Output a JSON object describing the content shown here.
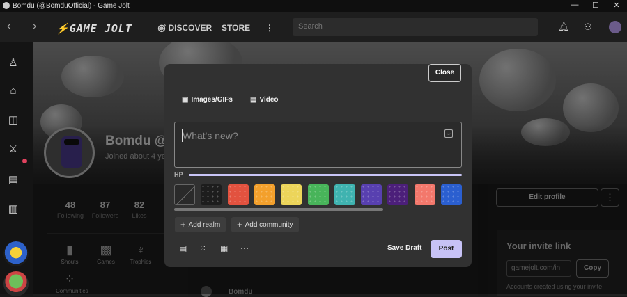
{
  "window": {
    "title": "Bomdu (@BomduOfficial) - Game Jolt",
    "minimize": "—",
    "maximize": "☐",
    "close": "✕"
  },
  "nav": {
    "back": "‹",
    "forward": "›",
    "logo": "GAME JOLT",
    "discover": "DISCOVER",
    "store": "STORE",
    "more": "⋮",
    "search_placeholder": "Search"
  },
  "profile": {
    "name": "Bomdu @",
    "joined": "Joined about 4 ye",
    "stats": [
      {
        "num": "48",
        "label": "Following"
      },
      {
        "num": "87",
        "label": "Followers"
      },
      {
        "num": "82",
        "label": "Likes"
      }
    ],
    "tabs": [
      {
        "label": "Shouts",
        "icon": "chat-bubble-icon"
      },
      {
        "label": "Games",
        "icon": "gamepad-icon"
      },
      {
        "label": "Trophies",
        "icon": "trophy-icon"
      },
      {
        "label": "Communities",
        "icon": "communities-icon"
      }
    ],
    "edit_profile": "Edit profile",
    "more": "⋮"
  },
  "invite": {
    "heading": "Your invite link",
    "link": "gamejolt.com/in",
    "copy": "Copy",
    "note": "Accounts created using your invite"
  },
  "feed": {
    "post_name": "Bomdu"
  },
  "composer": {
    "close": "Close",
    "images_gifs": "Images/GIFs",
    "video": "Video",
    "placeholder": "What's new?",
    "hp_label": "HP",
    "hp_fraction": 1.0,
    "add_realm": "Add realm",
    "add_community": "Add community",
    "save_draft": "Save Draft",
    "post": "Post",
    "backgrounds": [
      {
        "name": "none",
        "color": "#2a2a2a"
      },
      {
        "name": "dark-speckle",
        "color": "#1d1d1d"
      },
      {
        "name": "red-bubbles",
        "color": "#e2523f"
      },
      {
        "name": "orange-dots",
        "color": "#f3a02c"
      },
      {
        "name": "yellow-stripes",
        "color": "#ecd55a"
      },
      {
        "name": "green-dots",
        "color": "#48b45a"
      },
      {
        "name": "teal-dots",
        "color": "#3fb3b0"
      },
      {
        "name": "purple-pattern",
        "color": "#5840b0"
      },
      {
        "name": "violet-dots",
        "color": "#4c1f7a"
      },
      {
        "name": "salmon",
        "color": "#f3786c"
      },
      {
        "name": "blue-shapes",
        "color": "#2b5fd0"
      }
    ]
  }
}
